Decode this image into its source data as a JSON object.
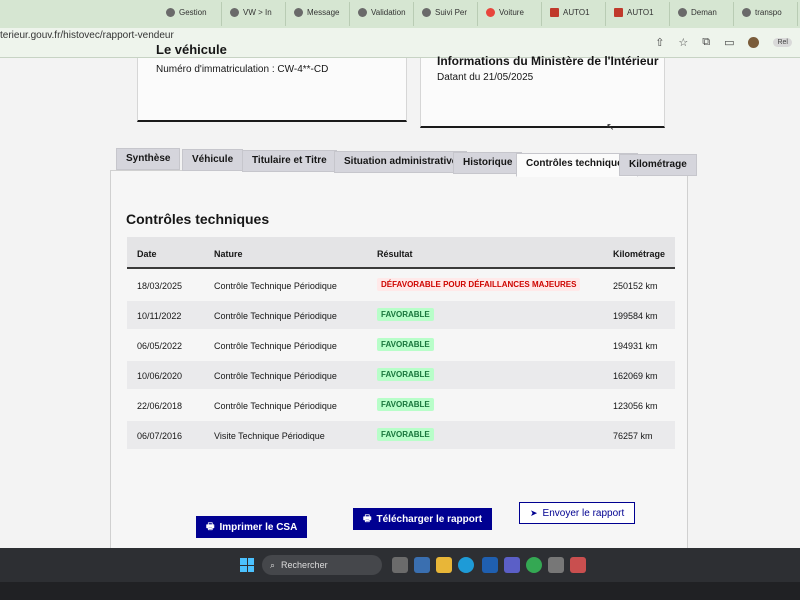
{
  "browser": {
    "tabs": [
      {
        "label": "Gestion",
        "icon": "site-icon"
      },
      {
        "label": "VW > In",
        "icon": "site-icon"
      },
      {
        "label": "Message",
        "icon": "mail-icon"
      },
      {
        "label": "Validation",
        "icon": "site-icon"
      },
      {
        "label": "Suivi Per",
        "icon": "site-icon"
      },
      {
        "label": "Voiture",
        "icon": "google-icon"
      },
      {
        "label": "AUTO1",
        "icon": "auto1-icon"
      },
      {
        "label": "AUTO1",
        "icon": "auto1-icon"
      },
      {
        "label": "Deman",
        "icon": "page-icon"
      },
      {
        "label": "transpo",
        "icon": "page-icon"
      }
    ],
    "url": "terieur.gouv.fr/histovec/rapport-vendeur",
    "extension_badge": "Rel"
  },
  "vehicle_card": {
    "title": "Le véhicule",
    "plate_label": "Numéro d'immatriculation : CW-4**-CD"
  },
  "ministry_card": {
    "title": "Informations du Ministère de l'Intérieur",
    "date_label": "Datant du 21/05/2025"
  },
  "tabs": [
    {
      "label": "Synthèse",
      "active": false
    },
    {
      "label": "Véhicule",
      "active": false
    },
    {
      "label": "Titulaire et Titre",
      "active": false
    },
    {
      "label": "Situation administrative",
      "active": false
    },
    {
      "label": "Historique",
      "active": false
    },
    {
      "label": "Contrôles techniques",
      "active": true
    },
    {
      "label": "Kilométrage",
      "active": false
    }
  ],
  "controls": {
    "title": "Contrôles techniques",
    "columns": [
      "Date",
      "Nature",
      "Résultat",
      "Kilométrage"
    ],
    "rows": [
      {
        "date": "18/03/2025",
        "nature": "Contrôle Technique Périodique",
        "result": "DÉFAVORABLE POUR DÉFAILLANCES MAJEURES",
        "status": "ko",
        "km": "250152 km"
      },
      {
        "date": "10/11/2022",
        "nature": "Contrôle Technique Périodique",
        "result": "FAVORABLE",
        "status": "ok",
        "km": "199584 km"
      },
      {
        "date": "06/05/2022",
        "nature": "Contrôle Technique Périodique",
        "result": "FAVORABLE",
        "status": "ok",
        "km": "194931 km"
      },
      {
        "date": "10/06/2020",
        "nature": "Contrôle Technique Périodique",
        "result": "FAVORABLE",
        "status": "ok",
        "km": "162069 km"
      },
      {
        "date": "22/06/2018",
        "nature": "Contrôle Technique Périodique",
        "result": "FAVORABLE",
        "status": "ok",
        "km": "123056 km"
      },
      {
        "date": "06/07/2016",
        "nature": "Visite Technique Périodique",
        "result": "FAVORABLE",
        "status": "ok",
        "km": "76257 km"
      }
    ]
  },
  "actions": {
    "print_csa": "Imprimer le CSA",
    "download": "Télécharger le rapport",
    "send": "Envoyer le rapport"
  },
  "taskbar": {
    "search_placeholder": "Rechercher"
  },
  "colors": {
    "primary": "#000091",
    "success_bg": "#b8fec9",
    "success_text": "#18753c",
    "error_bg": "#ffe9e9",
    "error_text": "#ce0500"
  }
}
